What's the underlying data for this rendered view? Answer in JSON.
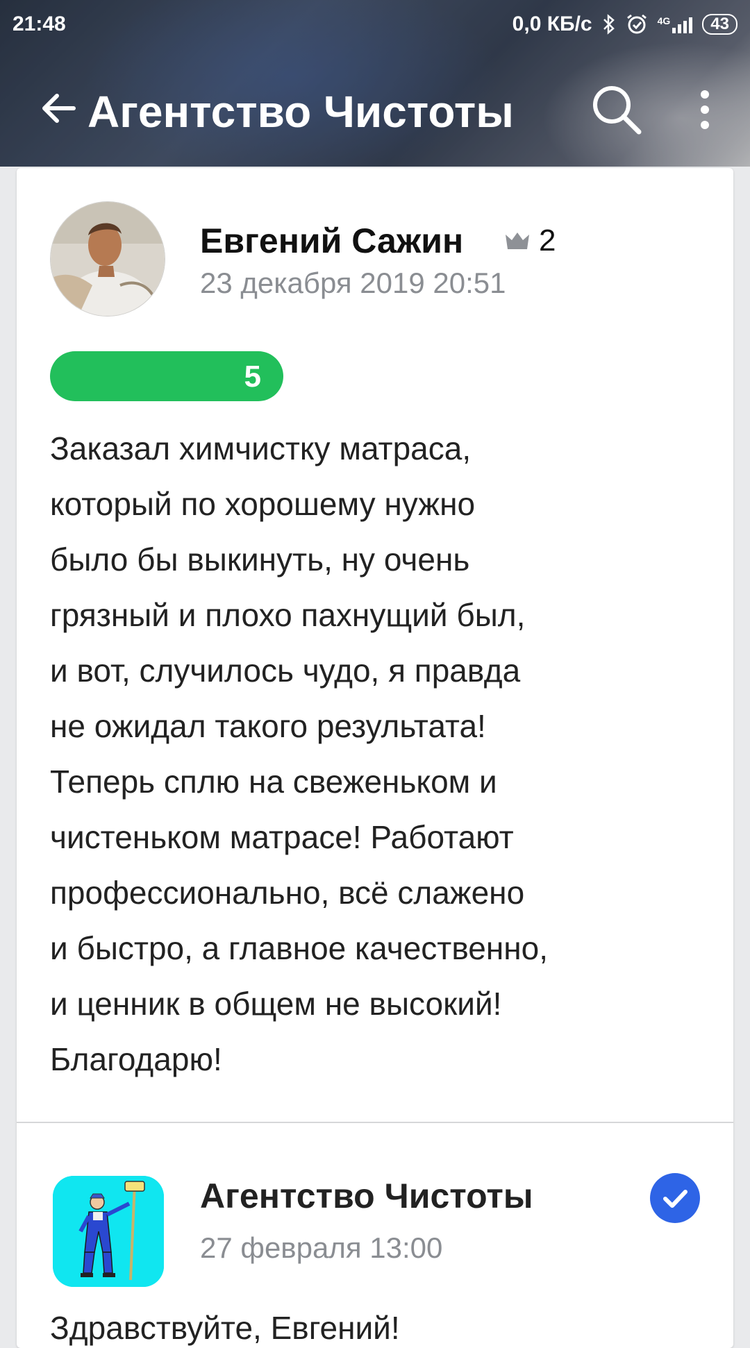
{
  "status_bar": {
    "time": "21:48",
    "network_speed": "0,0 КБ/с",
    "network_type": "4G",
    "battery": "43",
    "icons": [
      "bluetooth-icon",
      "alarm-icon",
      "signal-icon",
      "battery-icon"
    ]
  },
  "toolbar": {
    "title": "Агентство Чистоты",
    "back_icon": "arrow-left-icon",
    "search_icon": "search-icon",
    "more_icon": "more-vertical-icon"
  },
  "review": {
    "author": "Евгений Сажин",
    "level": "2",
    "date": "23 декабря 2019 20:51",
    "rating": "5",
    "text_lines": [
      "Заказал химчистку матраса,",
      "который по хорошему нужно",
      "было бы выкинуть, ну очень",
      "грязный и плохо пахнущий был,",
      "и вот, случилось чудо, я правда",
      "не ожидал такого результата!",
      "Теперь сплю на свеженьком и",
      "чистеньком матрасе! Работают",
      "профессионально, всё слажено",
      "и быстро, а главное качественно,",
      "и ценник в общем не высокий!",
      "Благодарю!"
    ]
  },
  "reply": {
    "author": "Агентство Чистоты",
    "date": "27 февраля 13:00",
    "text": "Здравствуйте, Евгений!"
  },
  "colors": {
    "rating_green": "#22bf5b",
    "verified_blue": "#2e64e6",
    "secondary_text": "#8a8d92",
    "reply_avatar_bg": "#10e6f0"
  }
}
